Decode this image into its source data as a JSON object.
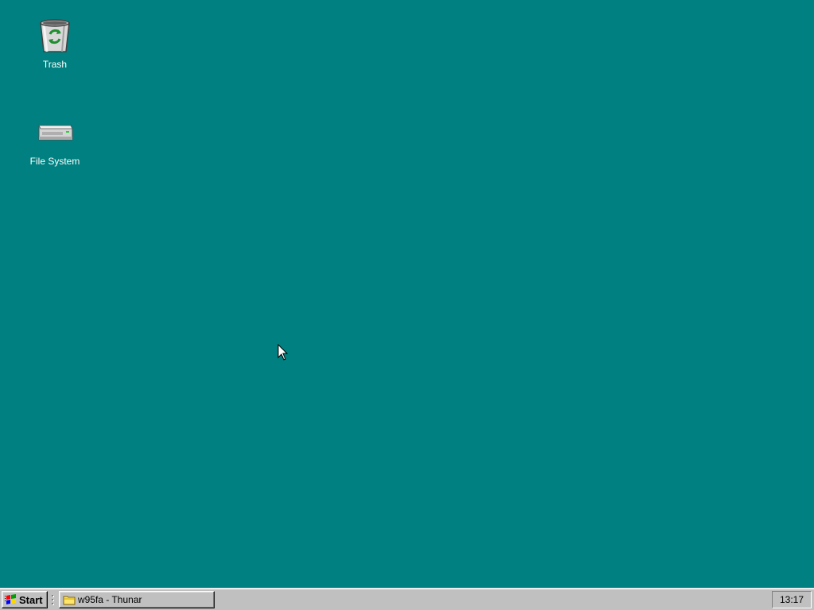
{
  "desktop": {
    "background_color": "#008080",
    "icons": [
      {
        "label": "Trash",
        "icon": "trash-icon"
      },
      {
        "label": "File System",
        "icon": "hard-drive-icon"
      }
    ]
  },
  "taskbar": {
    "start_label": "Start",
    "tasks": [
      {
        "label": "w95fa - Thunar",
        "icon": "folder-icon"
      }
    ],
    "clock": "13:17"
  }
}
